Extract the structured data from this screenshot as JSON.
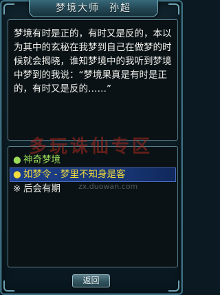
{
  "window": {
    "title_name": "梦境大师",
    "title_npc": "孙超"
  },
  "dialog": {
    "text": "梦境有时是正的，有时又是反的，本以为其中的玄秘在我梦到自己在做梦的时候就会揭晓，谁知梦境中的我听到梦境中梦到的我说：“梦境果真是有时是正的，有时又是反的……”"
  },
  "watermark": {
    "text": "多玩诛仙专区",
    "url": "zx.duowan.com"
  },
  "options": [
    {
      "bullet": "●",
      "label": "神奇梦境",
      "color": "green"
    },
    {
      "bullet": "●",
      "label": "如梦令 - 梦里不知身是客",
      "color": "yellow",
      "selected": true
    },
    {
      "bullet": "※",
      "label": "后会有期",
      "color": "white"
    }
  ],
  "buttons": {
    "return_label": "返回"
  },
  "colors": {
    "option_green": "#9bdc5a",
    "option_yellow": "#f3dd3c",
    "selection_bg": "#1d3f8c",
    "panel_border": "#587f8a"
  }
}
